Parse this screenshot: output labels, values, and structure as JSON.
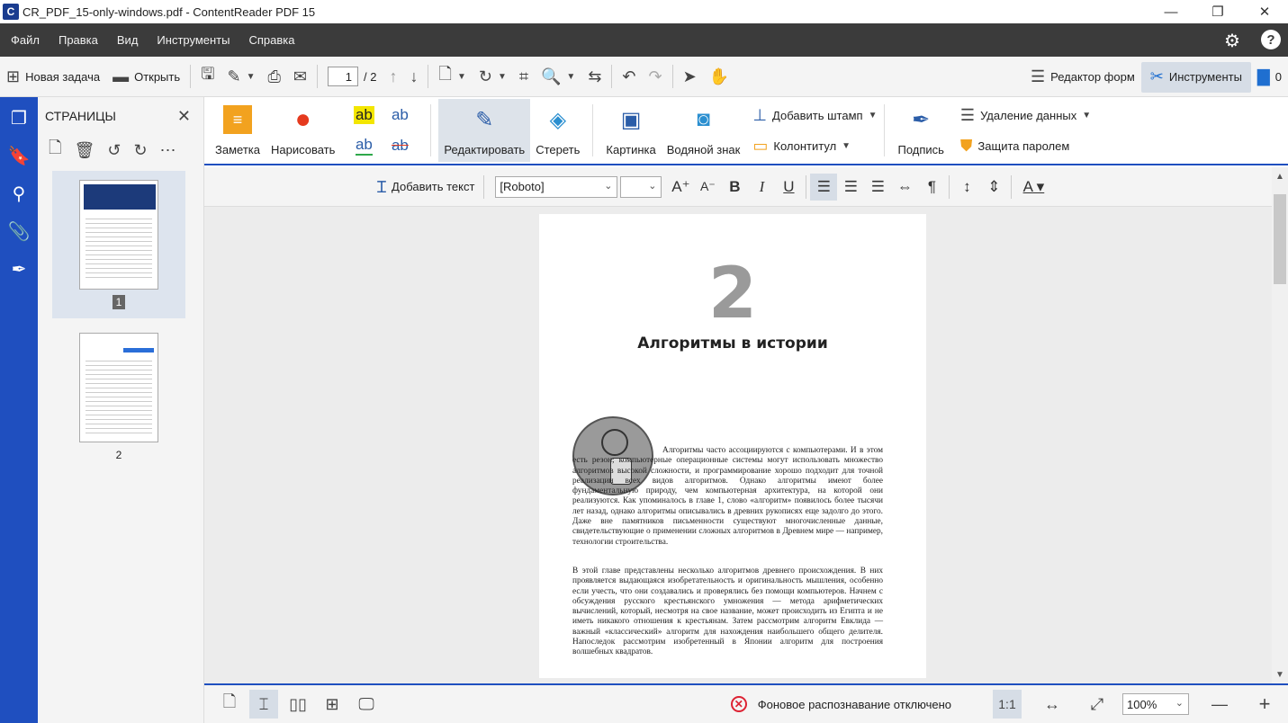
{
  "window": {
    "title": "CR_PDF_15-only-windows.pdf - ContentReader PDF 15",
    "logo": "C",
    "minimize": "—",
    "restore": "❐",
    "close": "✕"
  },
  "menu": {
    "items": [
      "Файл",
      "Правка",
      "Вид",
      "Инструменты",
      "Справка"
    ]
  },
  "toolbar": {
    "new_task": "Новая задача",
    "open": "Открыть",
    "page_current": "1",
    "page_total": "/ 2",
    "form_editor": "Редактор форм",
    "tools": "Инструменты",
    "comments_count": "0"
  },
  "pages_panel": {
    "title": "СТРАНИЦЫ",
    "thumbnails": [
      {
        "label": "1"
      },
      {
        "label": "2"
      }
    ]
  },
  "ribbon": {
    "note": "Заметка",
    "draw": "Нарисовать",
    "edit": "Редактировать",
    "erase": "Стереть",
    "picture": "Картинка",
    "watermark": "Водяной знак",
    "add_stamp": "Добавить штамп",
    "header_footer": "Колонтитул",
    "signature": "Подпись",
    "redact": "Удаление данных",
    "password": "Защита паролем",
    "text_ab": "ab"
  },
  "format_bar": {
    "add_text": "Добавить текст",
    "font": "[Roboto]",
    "size": ""
  },
  "document": {
    "chapter_number": "2",
    "chapter_title": "Алгоритмы в истории",
    "para1": "Алгоритмы часто ассоциируются с компьютерами. И в этом есть резон; компьютерные операционные системы могут использовать множество алгоритмов высокой сложности, и программирование хорошо подходит для точной реализации всех видов алгоритмов. Однако алгоритмы имеют более фундаментальную природу, чем компьютерная архитектура, на которой они реализуются. Как упоминалось в главе 1, слово «алгоритм» появилось более тысячи лет назад, однако алгоритмы описывались в древних рукописях еще задолго до этого. Даже вне памятников письменности существуют многочисленные данные, свидетельствующие о применении сложных алгоритмов в Древнем мире — например, технологии строительства.",
    "para2": "В этой главе представлены несколько алгоритмов древнего происхождения. В них проявляется выдающаяся изобретательность и оригинальность мышления, особенно если учесть, что они создавались и проверялись без помощи компьютеров. Начнем с обсуждения русского крестьянского умножения — метода арифметических вычислений, который, несмотря на свое название, может происходить из Египта и не иметь никакого отношения к крестьянам. Затем рассмотрим алгоритм Евклида — важный «классический» алгоритм для нахождения наибольшего общего делителя. Напоследок рассмотрим изобретенный в Японии алгоритм для построения волшебных квадратов."
  },
  "status": {
    "recognition": "Фоновое распознавание отключено",
    "ratio": "1:1",
    "zoom": "100%",
    "zoom_out": "—",
    "zoom_in": "+"
  }
}
